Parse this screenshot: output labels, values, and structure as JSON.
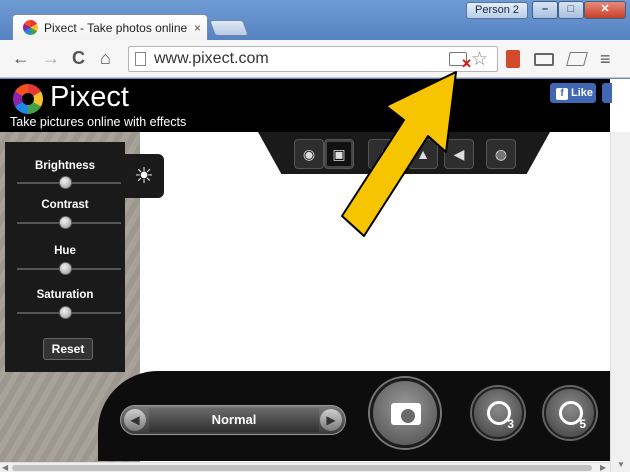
{
  "browser": {
    "tab_title": "Pixect - Take photos online",
    "tab_close": "×",
    "profile": "Person 2",
    "window_buttons": {
      "minimize": "–",
      "maximize": "□",
      "close": "✕"
    },
    "url": "www.pixect.com",
    "nav": {
      "back": "←",
      "forward": "→",
      "reload": "C",
      "home": "⌂"
    },
    "menu_icon": "≡"
  },
  "site": {
    "brand": "Pixect",
    "tagline": "Take pictures online with effects",
    "fb_like": "Like",
    "fb_icon": "f",
    "brightness_icon": "☀"
  },
  "panel": {
    "sliders": [
      {
        "label": "Brightness",
        "value": 0.5
      },
      {
        "label": "Contrast",
        "value": 0.5
      },
      {
        "label": "Hue",
        "value": 0.5
      },
      {
        "label": "Saturation",
        "value": 0.5
      }
    ],
    "reset": "Reset"
  },
  "bottom": {
    "effect": "Normal",
    "timers": [
      "3",
      "5"
    ]
  }
}
